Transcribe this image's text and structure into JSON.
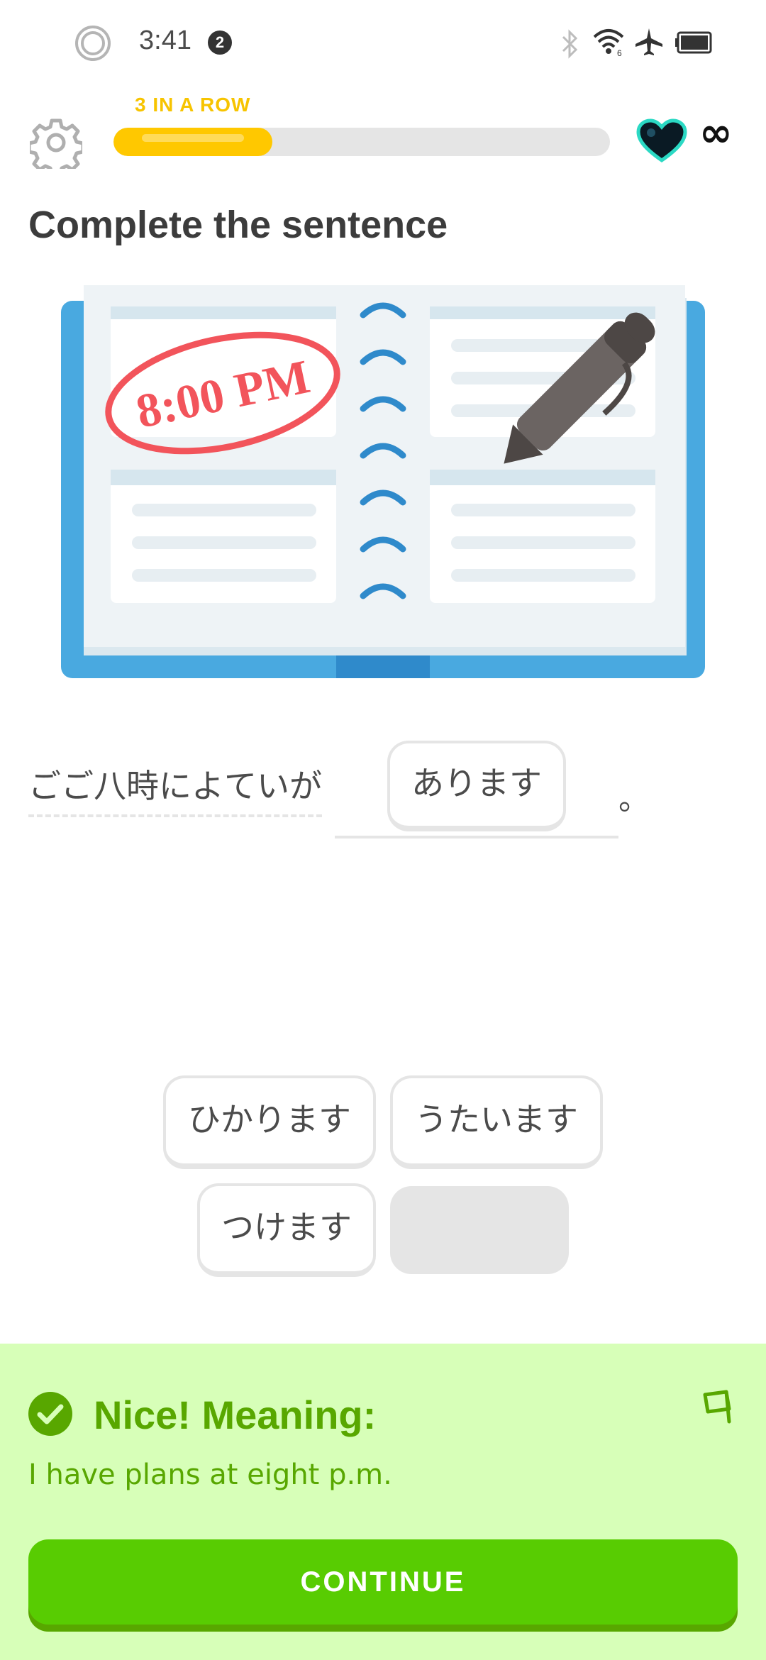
{
  "status_bar": {
    "time": "3:41",
    "notification_count": "2"
  },
  "header": {
    "streak_label": "3 IN A ROW",
    "progress": 0.32,
    "hearts": "∞"
  },
  "exercise": {
    "title": "Complete the sentence",
    "illustration": {
      "label": "8:00 PM"
    },
    "sentence_prompt": "ごご八時によていが",
    "selected_answer": "あります",
    "sentence_end": "。",
    "word_bank": [
      "ひかります",
      "うたいます",
      "つけます"
    ]
  },
  "feedback": {
    "title": "Nice! Meaning:",
    "meaning": "I have plans at eight p.m.",
    "continue_label": "CONTINUE"
  },
  "colors": {
    "accent_green": "#58cc02",
    "feedback_bg": "#d7ffb8",
    "feedback_text": "#58a700",
    "progress_fill": "#ffc800",
    "streak_text": "#f7c400",
    "heart": "#1cb0f6"
  }
}
